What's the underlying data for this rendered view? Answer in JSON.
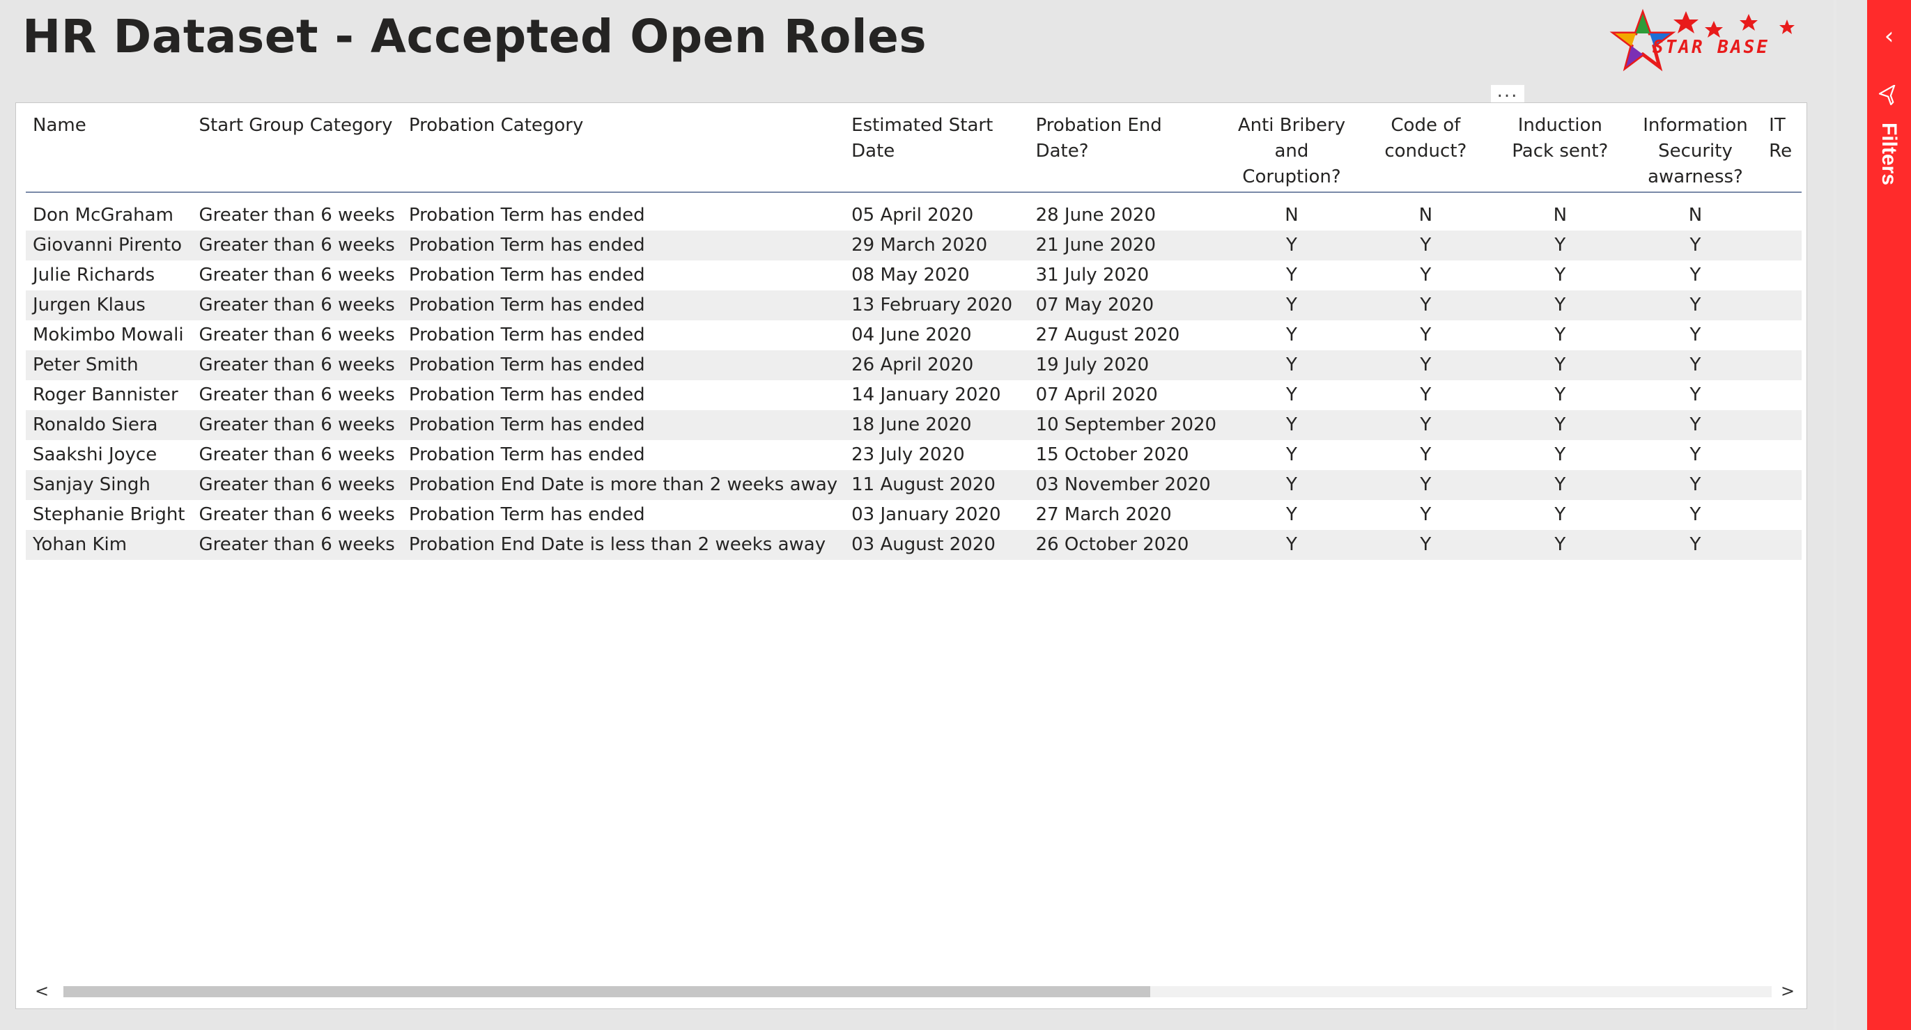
{
  "page": {
    "title": "HR Dataset - Accepted Open Roles",
    "logo_text": "STAR BASE"
  },
  "filters_pane": {
    "label": "Filters",
    "collapse_icon": "chevron-left-icon",
    "filter_icon": "funnel-icon",
    "color": "#ff2b2b"
  },
  "visual": {
    "more_options_label": "...",
    "scroll_left": "<",
    "scroll_right": ">"
  },
  "table": {
    "columns": [
      "Name",
      "Start Group Category",
      "Probation Category",
      "Estimated Start Date",
      "Probation End Date?",
      "Anti Bribery and Coruption?",
      "Code of conduct?",
      "Induction Pack sent?",
      "Information Security awarness?",
      "IT Re"
    ],
    "rows": [
      [
        "Don McGraham",
        "Greater than 6 weeks",
        "Probation Term has ended",
        "05 April 2020",
        "28 June 2020",
        "N",
        "N",
        "N",
        "N"
      ],
      [
        "Giovanni Pirento",
        "Greater than 6 weeks",
        "Probation Term has ended",
        "29 March 2020",
        "21 June 2020",
        "Y",
        "Y",
        "Y",
        "Y"
      ],
      [
        "Julie Richards",
        "Greater than 6 weeks",
        "Probation Term has ended",
        "08 May 2020",
        "31 July 2020",
        "Y",
        "Y",
        "Y",
        "Y"
      ],
      [
        "Jurgen Klaus",
        "Greater than 6 weeks",
        "Probation Term has ended",
        "13 February 2020",
        "07 May 2020",
        "Y",
        "Y",
        "Y",
        "Y"
      ],
      [
        "Mokimbo Mowali",
        "Greater than 6 weeks",
        "Probation Term has ended",
        "04 June 2020",
        "27 August 2020",
        "Y",
        "Y",
        "Y",
        "Y"
      ],
      [
        "Peter Smith",
        "Greater than 6 weeks",
        "Probation Term has ended",
        "26 April 2020",
        "19 July 2020",
        "Y",
        "Y",
        "Y",
        "Y"
      ],
      [
        "Roger Bannister",
        "Greater than 6 weeks",
        "Probation Term has ended",
        "14 January 2020",
        "07 April 2020",
        "Y",
        "Y",
        "Y",
        "Y"
      ],
      [
        "Ronaldo Siera",
        "Greater than 6 weeks",
        "Probation Term has ended",
        "18 June 2020",
        "10 September 2020",
        "Y",
        "Y",
        "Y",
        "Y"
      ],
      [
        "Saakshi Joyce",
        "Greater than 6 weeks",
        "Probation Term has ended",
        "23 July 2020",
        "15 October 2020",
        "Y",
        "Y",
        "Y",
        "Y"
      ],
      [
        "Sanjay Singh",
        "Greater than 6 weeks",
        "Probation End Date is more than 2 weeks away",
        "11 August 2020",
        "03 November 2020",
        "Y",
        "Y",
        "Y",
        "Y"
      ],
      [
        "Stephanie Bright",
        "Greater than 6 weeks",
        "Probation Term has ended",
        "03 January 2020",
        "27 March 2020",
        "Y",
        "Y",
        "Y",
        "Y"
      ],
      [
        "Yohan Kim",
        "Greater than 6 weeks",
        "Probation End Date is less than 2 weeks away",
        "03 August 2020",
        "26 October 2020",
        "Y",
        "Y",
        "Y",
        "Y"
      ]
    ]
  }
}
